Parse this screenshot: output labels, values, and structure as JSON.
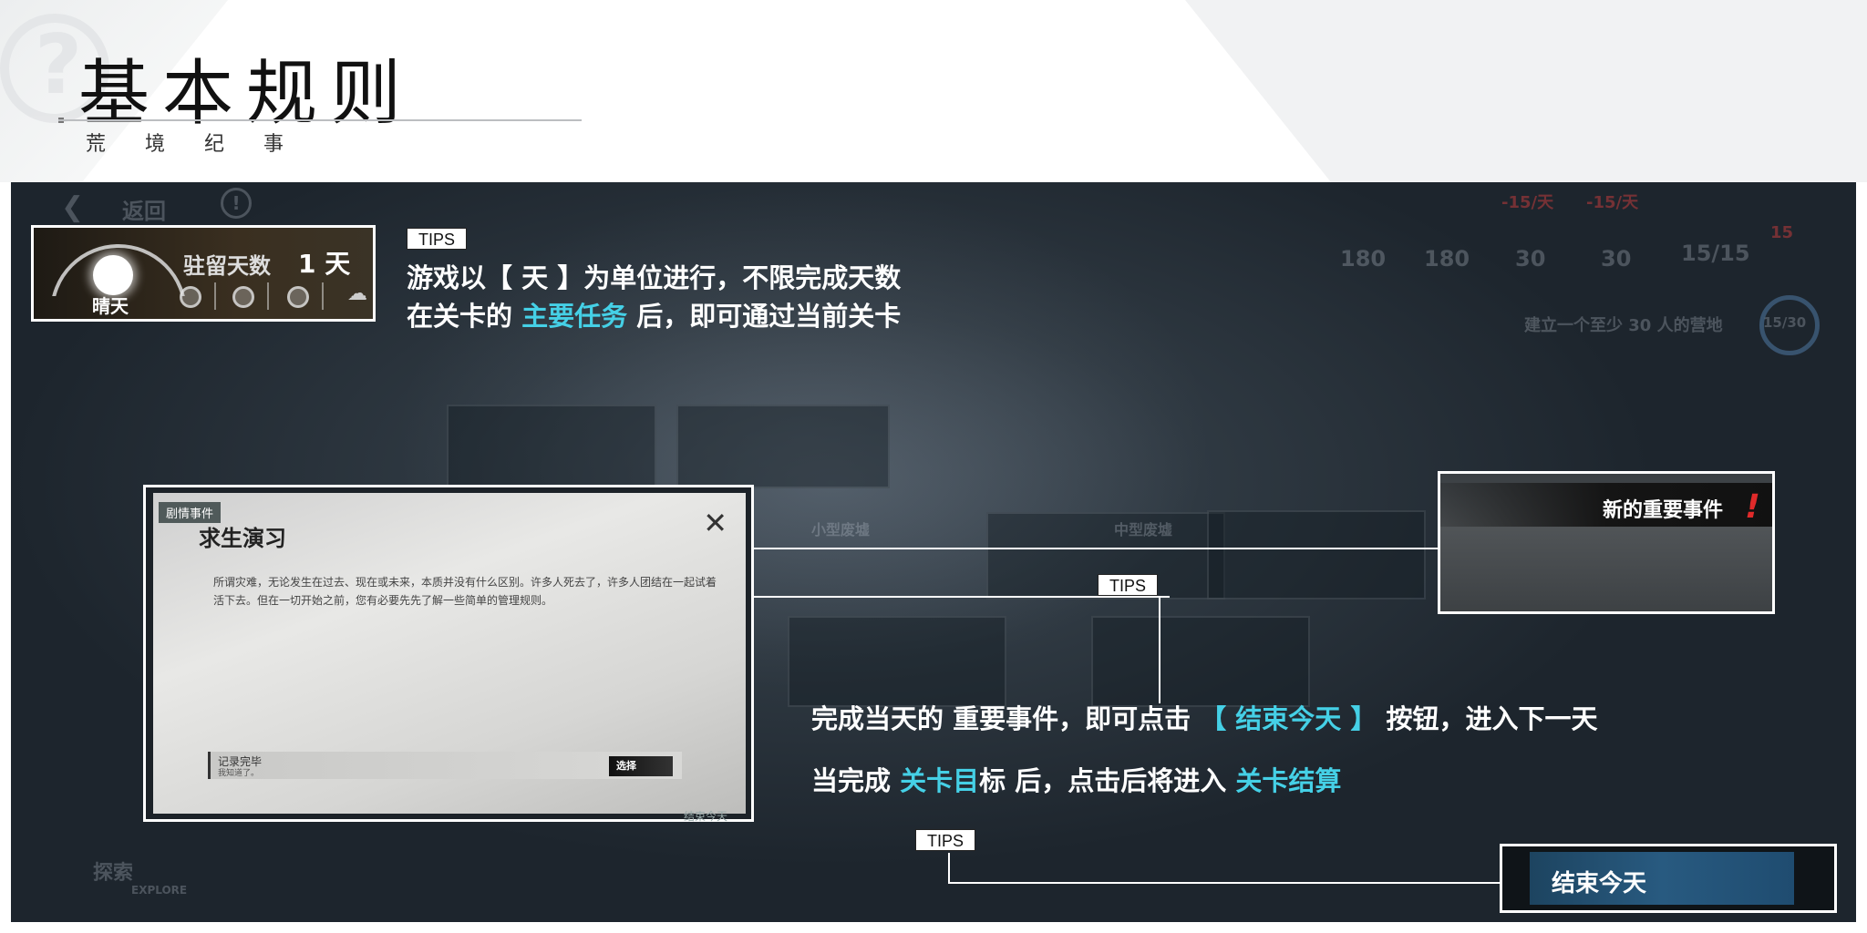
{
  "header": {
    "title": "基本规则",
    "subtitle": "荒 境 纪 事"
  },
  "game_hud": {
    "back_label": "返回",
    "resource_values": [
      "180",
      "180",
      "30",
      "30",
      "15/15"
    ],
    "resource_rates": [
      "-15/天",
      "-15/天"
    ],
    "population_flag": "15",
    "objective_text": "建立一个至少 30 人的营地",
    "objective_progress": "15/30",
    "map_labels": [
      "小型废墟",
      "中型废墟"
    ],
    "explore_label": "探索",
    "explore_sub": "EXPLORE"
  },
  "weather": {
    "weather_label": "晴天",
    "days_label": "驻留天数",
    "days_value": "1 天"
  },
  "tips": {
    "tag": "TIPS",
    "tip1_line1": "游戏以【 天 】为单位进行，不限完成天数",
    "tip1_line2_pre": "在关卡的 ",
    "tip1_line2_hl": "主要任务",
    "tip1_line2_post": " 后，即可通过当前关卡",
    "tip2_line1_pre": "完成当天的 重要事件，即可点击 ",
    "tip2_line1_hl": "【 结束今天 】",
    "tip2_line1_post": " 按钮，进入下一天",
    "tip2_line2_pre": "当完成 ",
    "tip2_line2_hl1": "关卡目",
    "tip2_line2_mid": "标 后，点击后将进入 ",
    "tip2_line2_hl2": "关卡结算"
  },
  "event_window": {
    "tag": "剧情事件",
    "title": "求生演习",
    "body": "所谓灾难，无论发生在过去、现在或未来，本质并没有什么区别。许多人死去了，许多人团结在一起试着活下去。但在一切开始之前，您有必要先先了解一些简单的管理规则。",
    "footer_title": "记录完毕",
    "footer_sub": "我知道了。",
    "choose_label": "选择",
    "end_label": "结束今天"
  },
  "important_event": {
    "label": "新的重要事件"
  },
  "end_day": {
    "label": "结束今天"
  },
  "colors": {
    "highlight": "#45d0e6",
    "alert": "#e02a2a"
  }
}
